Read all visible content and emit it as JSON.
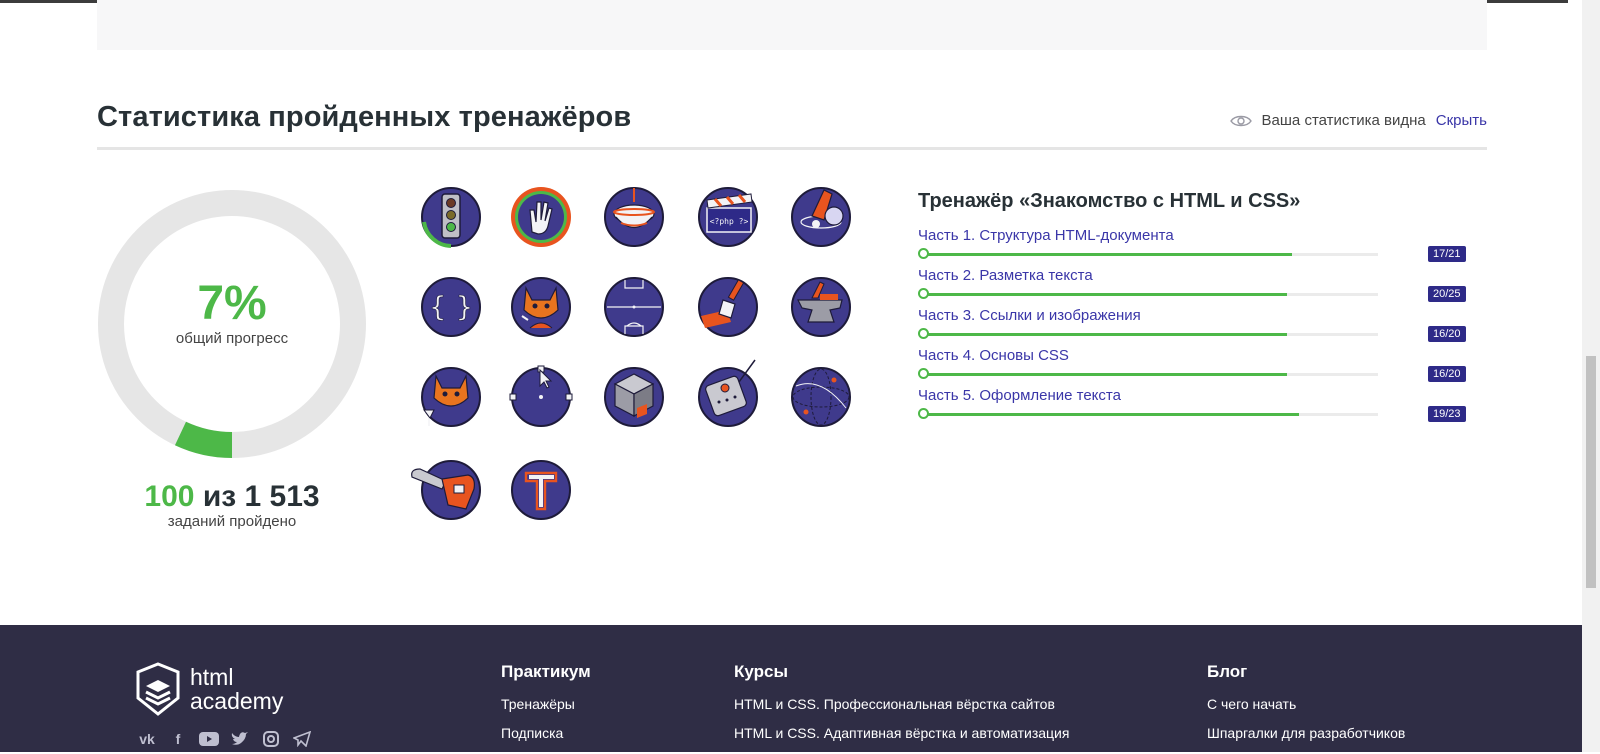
{
  "stats": {
    "title": "Статистика пройденных тренажёров",
    "visibility_text": "Ваша статистика видна",
    "hide_label": "Скрыть"
  },
  "progress": {
    "percent_text": "7%",
    "percent_value": 7,
    "percent_label": "общий прогресс",
    "done": "100",
    "of": "из 1 513",
    "done_label": "заданий пройдено"
  },
  "badges": [
    {
      "name": "traffic-light-badge"
    },
    {
      "name": "hand-badge",
      "selected": true
    },
    {
      "name": "spinning-top-badge"
    },
    {
      "name": "php-clapperboard-badge"
    },
    {
      "name": "space-badge"
    },
    {
      "name": "curly-braces-badge"
    },
    {
      "name": "cat-badge"
    },
    {
      "name": "football-field-badge"
    },
    {
      "name": "paint-brush-badge"
    },
    {
      "name": "anvil-badge"
    },
    {
      "name": "cat-with-glass-badge"
    },
    {
      "name": "vector-cursor-badge"
    },
    {
      "name": "cube-badge"
    },
    {
      "name": "robot-remote-badge"
    },
    {
      "name": "globe-badge"
    },
    {
      "name": "chainsaw-badge"
    },
    {
      "name": "letter-t-badge"
    }
  ],
  "trainer": {
    "title": "Тренажёр «Знакомство с HTML и CSS»",
    "parts": [
      {
        "label": "Часть 1. Структура HTML-документа",
        "score": "17/21",
        "done": 17,
        "total": 21
      },
      {
        "label": "Часть 2. Разметка текста",
        "score": "20/25",
        "done": 20,
        "total": 25
      },
      {
        "label": "Часть 3. Ссылки и изображения",
        "score": "16/20",
        "done": 16,
        "total": 20
      },
      {
        "label": "Часть 4. Основы CSS",
        "score": "16/20",
        "done": 16,
        "total": 20
      },
      {
        "label": "Часть 5. Оформление текста",
        "score": "19/23",
        "done": 19,
        "total": 23
      }
    ]
  },
  "footer": {
    "logo_line1": "html",
    "logo_line2": "academy",
    "social": [
      "vk-icon",
      "facebook-icon",
      "youtube-icon",
      "twitter-icon",
      "instagram-icon",
      "telegram-icon"
    ],
    "col1": {
      "title": "Практикум",
      "links": [
        "Тренажёры",
        "Подписка"
      ]
    },
    "col2": {
      "title": "Курсы",
      "links": [
        "HTML и CSS. Профессиональная вёрстка сайтов",
        "HTML и CSS. Адаптивная вёрстка и автоматизация"
      ]
    },
    "col3": {
      "title": "Блог",
      "links": [
        "С чего начать",
        "Шпаргалки для разработчиков"
      ]
    }
  },
  "colors": {
    "accent_green": "#4db848",
    "link_purple": "#3a36a8",
    "badge_navy": "#3f3a8c",
    "footer_bg": "#2f2d45",
    "score_bg": "#2e2a88"
  }
}
